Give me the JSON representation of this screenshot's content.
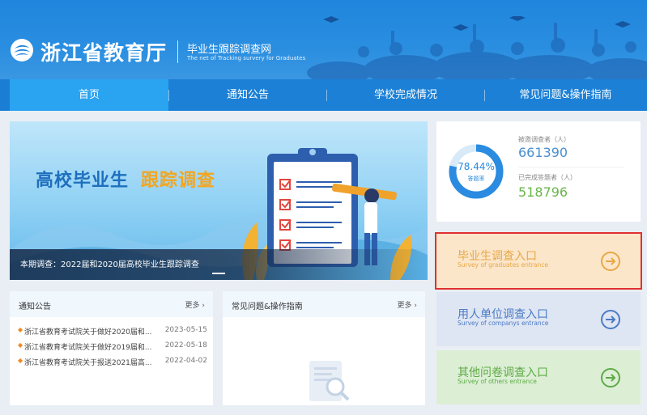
{
  "header": {
    "logo_text": "浙江省教育厅",
    "subtitle_cn": "毕业生跟踪调查网",
    "subtitle_en": "The net of Tracking survery for Graduates"
  },
  "nav": {
    "items": [
      {
        "label": "首页",
        "active": true
      },
      {
        "label": "通知公告"
      },
      {
        "label": "学校完成情况"
      },
      {
        "label": "常见问题&操作指南"
      }
    ]
  },
  "banner": {
    "title_part1": "高校毕业生",
    "title_part2": "跟踪调查",
    "caption": "本期调查：2022届和2020届高校毕业生跟踪调查"
  },
  "stats": {
    "ring_percent": "78.44%",
    "ring_fraction": 0.7844,
    "ring_label": "答题率",
    "invited_label": "被邀调查者（人）",
    "invited_value": "661390",
    "completed_label": "已完成答题者（人）",
    "completed_value": "518796"
  },
  "entrances": [
    {
      "cn": "毕业生调查入口",
      "en": "Survey of graduates entrance",
      "color": "#e9a746"
    },
    {
      "cn": "用人单位调查入口",
      "en": "Survey of companys entrance",
      "color": "#4a7bc6"
    },
    {
      "cn": "其他问卷调查入口",
      "en": "Survey of others entrance",
      "color": "#5eaa45"
    }
  ],
  "notices": {
    "title": "通知公告",
    "more": "更多 ›",
    "items": [
      {
        "text": "浙江省教育考试院关于做好2020届和...",
        "date": "2023-05-15"
      },
      {
        "text": "浙江省教育考试院关于做好2019届和...",
        "date": "2022-05-18"
      },
      {
        "text": "浙江省教育考试院关于报送2021届高...",
        "date": "2022-04-02"
      }
    ]
  },
  "faq": {
    "title": "常见问题&操作指南",
    "more": "更多 ›"
  },
  "colors": {
    "brand_blue": "#1f86dd",
    "nav_active": "#2aa3f0",
    "highlight_outline": "#e1302f"
  }
}
